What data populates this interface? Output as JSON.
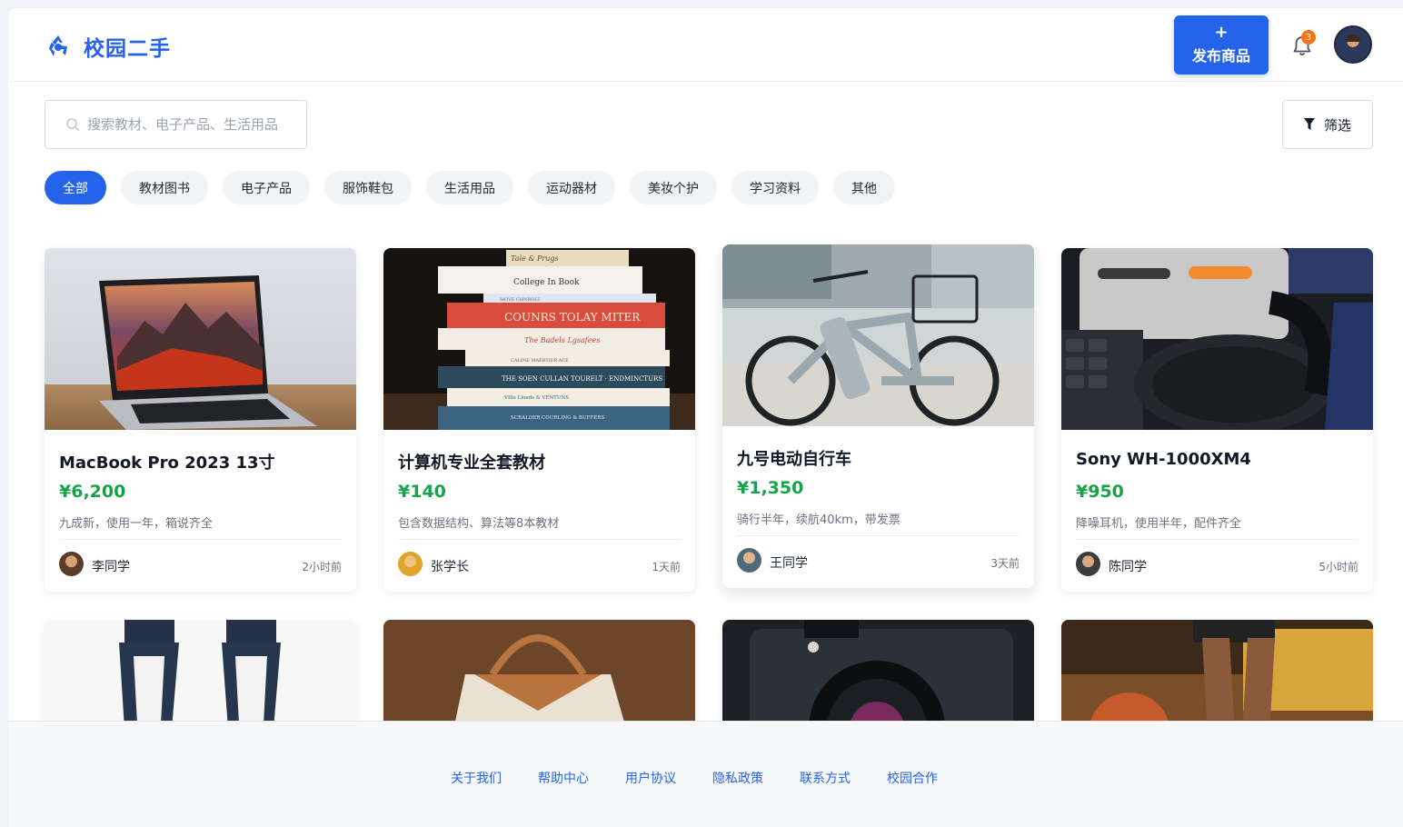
{
  "header": {
    "title": "校园二手",
    "publish_plus": "+",
    "publish_label": "发布商品",
    "notification_count": "3"
  },
  "search": {
    "placeholder": "搜索教材、电子产品、生活用品"
  },
  "filter": {
    "label": "筛选"
  },
  "categories": [
    "全部",
    "教材图书",
    "电子产品",
    "服饰鞋包",
    "生活用品",
    "运动器材",
    "美妆个护",
    "学习资料",
    "其他"
  ],
  "active_category": "全部",
  "products": [
    {
      "title": "MacBook Pro 2023 13寸",
      "price": "¥6,200",
      "desc": "九成新，使用一年，箱说齐全",
      "seller": "李同学",
      "time": "2小时前"
    },
    {
      "title": "计算机专业全套教材",
      "price": "¥140",
      "desc": "包含数据结构、算法等8本教材",
      "seller": "张学长",
      "time": "1天前"
    },
    {
      "title": "九号电动自行车",
      "price": "¥1,350",
      "desc": "骑行半年，续航40km，带发票",
      "seller": "王同学",
      "time": "3天前"
    },
    {
      "title": "Sony WH-1000XM4",
      "price": "¥950",
      "desc": "降噪耳机，使用半年，配件齐全",
      "seller": "陈同学",
      "time": "5小时前"
    }
  ],
  "book_spines": [
    "Tale & Prugs",
    "College In Book",
    "MOVE CHNROLT",
    "COUNRS TOLAY MITER",
    "The Badels Lgsafees",
    "CALINE MAERTIER ACE",
    "THE SOEN CULLAN TOURELT · ENDMINCTURS",
    "VIlle Lloeds & VENTUNS",
    "SCRALDER COURLING & BUFFERS"
  ],
  "footer": {
    "links": [
      "关于我们",
      "帮助中心",
      "用户协议",
      "隐私政策",
      "联系方式",
      "校园合作"
    ]
  },
  "colors": {
    "brand": "#2563eb",
    "price": "#16a34a",
    "badge": "#f97316"
  },
  "icons": {
    "brand": "recycle-icon",
    "bell": "bell-icon",
    "search": "search-icon",
    "filter": "filter-icon"
  }
}
